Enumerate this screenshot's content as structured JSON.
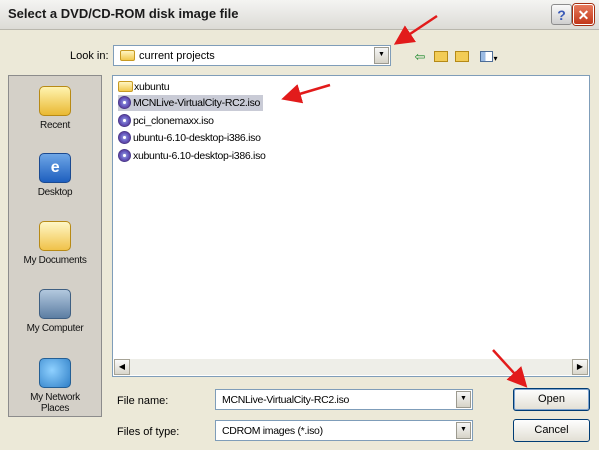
{
  "dialog": {
    "title": "Select a DVD/CD-ROM disk image file",
    "help_label": "?",
    "close_label": "✕"
  },
  "lookin": {
    "label": "Look in:",
    "value": "current projects"
  },
  "toolbar": {
    "back_icon": "back-arrow-icon",
    "up_icon": "up-folder-icon",
    "new_folder_icon": "new-folder-icon",
    "views_icon": "views-menu-icon"
  },
  "places": [
    {
      "label": "Recent"
    },
    {
      "label": "Desktop"
    },
    {
      "label": "My Documents"
    },
    {
      "label": "My Computer"
    },
    {
      "label": "My Network Places"
    }
  ],
  "files": [
    {
      "name": "xubuntu",
      "type": "folder",
      "selected": false
    },
    {
      "name": "MCNLive-VirtualCity-RC2.iso",
      "type": "iso",
      "selected": true
    },
    {
      "name": "pci_clonemaxx.iso",
      "type": "iso",
      "selected": false
    },
    {
      "name": "ubuntu-6.10-desktop-i386.iso",
      "type": "iso",
      "selected": false
    },
    {
      "name": "xubuntu-6.10-desktop-i386.iso",
      "type": "iso",
      "selected": false
    }
  ],
  "filename": {
    "label": "File name:",
    "value": "MCNLive-VirtualCity-RC2.iso"
  },
  "filetype": {
    "label": "Files of type:",
    "value": "CDROM images (*.iso)"
  },
  "buttons": {
    "open": "Open",
    "cancel": "Cancel"
  },
  "colors": {
    "selection": "#c9cbd6",
    "annotation_arrow": "#e21b1b"
  }
}
